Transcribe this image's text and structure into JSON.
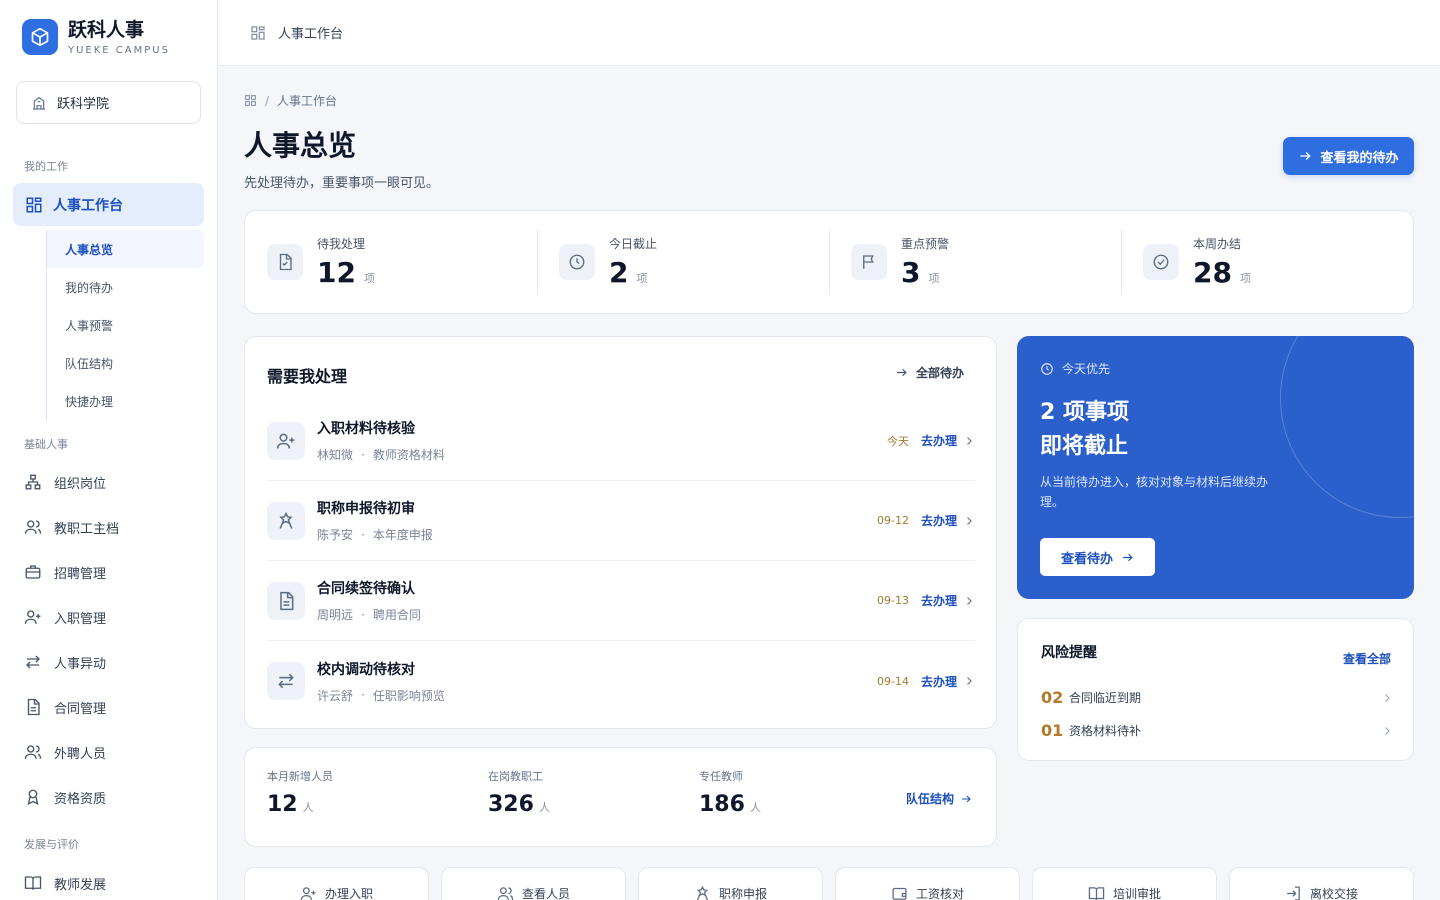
{
  "brand": {
    "name": "跃科人事",
    "sub": "YUEKE CAMPUS"
  },
  "org": {
    "name": "跃科学院"
  },
  "sidebar": {
    "group_work": "我的工作",
    "active": "人事工作台",
    "subnav": [
      "人事总览",
      "我的待办",
      "人事预警",
      "队伍结构",
      "快捷办理"
    ],
    "group_basic": "基础人事",
    "items": [
      "组织岗位",
      "教职工主档",
      "招聘管理",
      "入职管理",
      "人事异动",
      "合同管理",
      "外聘人员",
      "资格资质"
    ],
    "group_dev": "发展与评价",
    "dev_items": [
      "教师发展"
    ]
  },
  "topbar": {
    "title": "人事工作台"
  },
  "breadcrumb": {
    "sep": "/",
    "current": "人事工作台"
  },
  "page": {
    "title": "人事总览",
    "subtitle": "先处理待办，重要事项一眼可见。",
    "primary_action": "查看我的待办"
  },
  "stats": [
    {
      "label": "待我处理",
      "value": "12",
      "unit": "项",
      "icon": "file-check-icon"
    },
    {
      "label": "今日截止",
      "value": "2",
      "unit": "项",
      "icon": "clock-icon"
    },
    {
      "label": "重点预警",
      "value": "3",
      "unit": "项",
      "icon": "flag-icon"
    },
    {
      "label": "本周办结",
      "value": "28",
      "unit": "项",
      "icon": "check-circle-icon"
    }
  ],
  "todo": {
    "title": "需要我处理",
    "all_label": "全部待办",
    "action_label": "去办理",
    "items": [
      {
        "name": "入职材料待核验",
        "person": "林知微",
        "detail": "教师资格材料",
        "due": "今天",
        "icon": "user-plus-icon"
      },
      {
        "name": "职称申报待初审",
        "person": "陈予安",
        "detail": "本年度申报",
        "due": "09-12",
        "icon": "award-icon"
      },
      {
        "name": "合同续签待确认",
        "person": "周明远",
        "detail": "聘用合同",
        "due": "09-13",
        "icon": "document-icon"
      },
      {
        "name": "校内调动待核对",
        "person": "许云舒",
        "detail": "任职影响预览",
        "due": "09-14",
        "icon": "transfer-icon"
      }
    ]
  },
  "priority": {
    "kicker": "今天优先",
    "title_line1": "2 项事项",
    "title_line2": "即将截止",
    "desc": "从当前待办进入，核对对象与材料后继续办理。",
    "button": "查看待办"
  },
  "risk": {
    "title": "风险提醒",
    "all_label": "查看全部",
    "items": [
      {
        "num": "02",
        "label": "合同临近到期"
      },
      {
        "num": "01",
        "label": "资格材料待补"
      }
    ]
  },
  "team": {
    "stats": [
      {
        "label": "本月新增人员",
        "value": "12",
        "unit": "人"
      },
      {
        "label": "在岗教职工",
        "value": "326",
        "unit": "人"
      },
      {
        "label": "专任教师",
        "value": "186",
        "unit": "人"
      }
    ],
    "link": "队伍结构"
  },
  "quick": [
    "办理入职",
    "查看人员",
    "职称申报",
    "工资核对",
    "培训审批",
    "离校交接"
  ],
  "colors": {
    "primary": "#2f6ee0",
    "priority_bg": "#2b5fcb",
    "warning": "#b07a2a"
  }
}
